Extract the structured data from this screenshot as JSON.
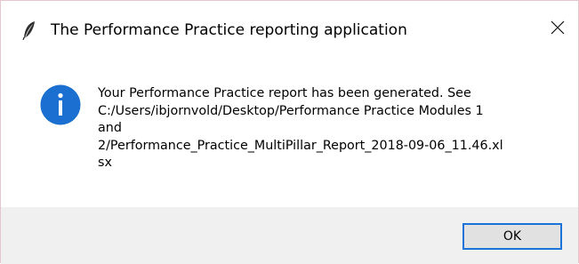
{
  "window": {
    "title": "The Performance Practice reporting application",
    "icon": "feather-icon"
  },
  "titlebar": {
    "close_icon": "close-icon"
  },
  "dialog": {
    "icon": "info-icon",
    "message_lines": [
      "Your Performance Practice report has been generated.  See",
      "C:/Users/ibjornvold/Desktop/Performance Practice Modules 1",
      "and",
      "2/Performance_Practice_MultiPillar_Report_2018-09-06_11.46.xl",
      "sx"
    ]
  },
  "buttons": {
    "ok_label": "OK"
  },
  "colors": {
    "info_blue": "#1a6fd0",
    "focus_border": "#1a73d9",
    "footer_bg": "#f0f0f0"
  }
}
